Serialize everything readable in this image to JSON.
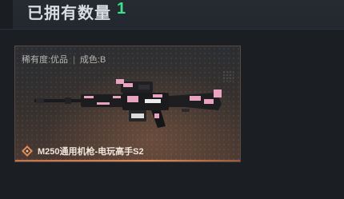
{
  "header": {
    "owned_label": "已拥有数量",
    "owned_count": "1"
  },
  "card": {
    "rarity_label": "稀有度:优品",
    "separator": "|",
    "condition_label": "成色:B",
    "weapon_name": "M250通用机枪-电玩高手S2",
    "quality_icon": "diamond-quality-icon",
    "weapon_image": "machine-gun-pink-skin-image"
  },
  "colors": {
    "count_accent": "#3ee08a",
    "quality_orange": "#e08a57",
    "skin_pink": "#e9a3c0"
  }
}
